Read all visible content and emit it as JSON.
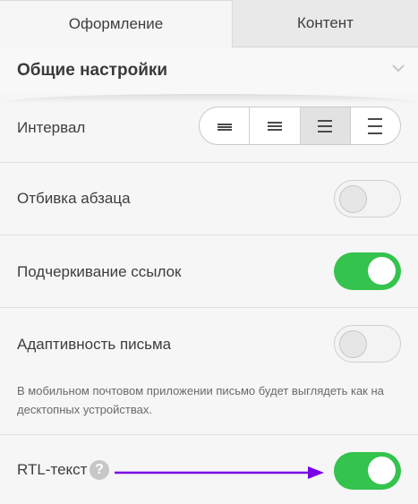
{
  "tabs": [
    {
      "label": "Оформление",
      "active": true
    },
    {
      "label": "Контент",
      "active": false
    }
  ],
  "section": {
    "title": "Общие настройки",
    "chevron_icon": "chevron-down-icon"
  },
  "interval": {
    "label": "Интервал",
    "options": [
      {
        "icon": "line-spacing-tight-icon",
        "selected": false
      },
      {
        "icon": "line-spacing-normal-icon",
        "selected": false
      },
      {
        "icon": "line-spacing-wide-icon",
        "selected": true
      },
      {
        "icon": "line-spacing-widest-icon",
        "selected": false
      }
    ]
  },
  "settings": [
    {
      "label": "Отбивка абзаца",
      "enabled": false
    },
    {
      "label": "Подчеркивание ссылок",
      "enabled": true
    },
    {
      "label": "Адаптивность письма",
      "enabled": false,
      "note": "В мобильном почтовом приложении письмо будет выглядеть как на десктопных устройствах."
    },
    {
      "label": "RTL-текст",
      "enabled": true,
      "help": "?",
      "annotation_icon": "arrow-right-icon"
    }
  ],
  "colors": {
    "toggle_on": "#34c34d",
    "arrow": "#7a00e6",
    "help_badge": "#c7c7c7"
  }
}
